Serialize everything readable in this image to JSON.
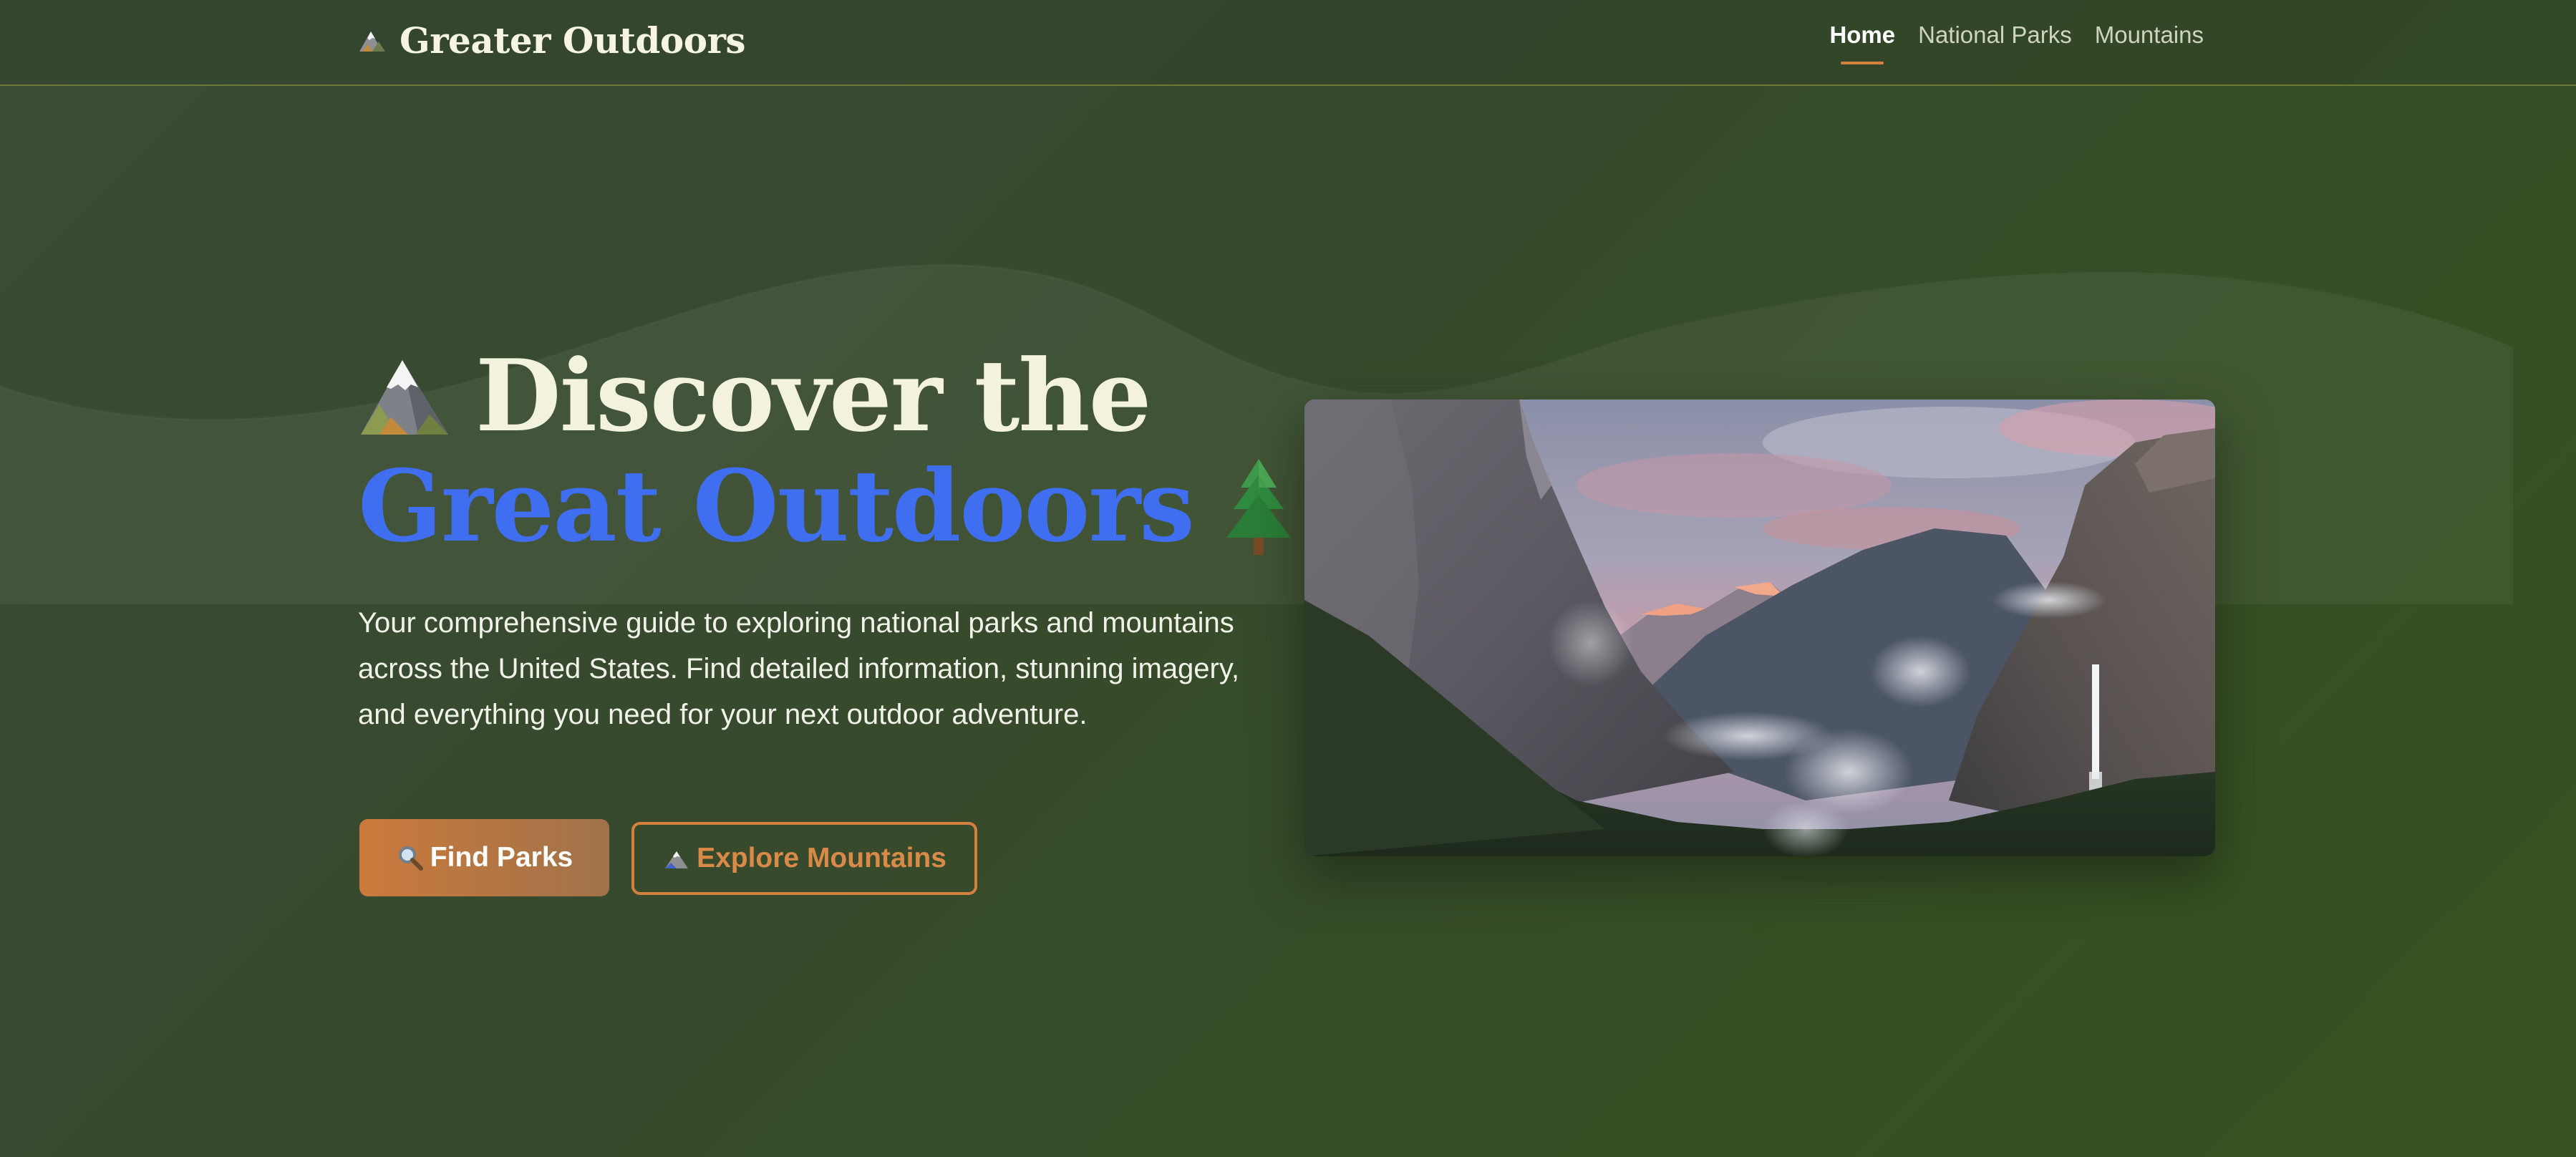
{
  "nav": {
    "brand": "Greater Outdoors",
    "brand_icon": "mountain-icon",
    "links": [
      {
        "label": "Home",
        "active": true
      },
      {
        "label": "National Parks",
        "active": false
      },
      {
        "label": "Mountains",
        "active": false
      }
    ]
  },
  "hero": {
    "title_line1": "Discover the",
    "title_line2": "Great Outdoors",
    "title_icon_left": "snow-capped-mountain-icon",
    "title_icon_right": "evergreen-tree-icon",
    "description": "Your comprehensive guide to exploring national parks and mountains across the United States. Find detailed information, stunning imagery, and everything you need for your next outdoor adventure.",
    "primary_button": {
      "label": "Find Parks",
      "icon": "magnifying-glass-icon"
    },
    "secondary_button": {
      "label": "Explore Mountains",
      "icon": "mountain-icon"
    },
    "image_icon": "mountain-valley-landscape"
  },
  "colors": {
    "background": "#394c30",
    "accent": "#d4803f",
    "title_highlight": "#3f6ff0",
    "title_text": "#f3f3dd"
  }
}
